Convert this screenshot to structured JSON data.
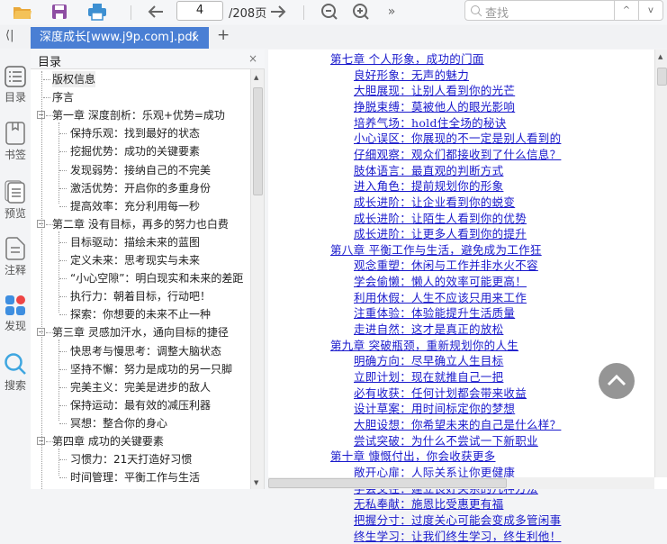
{
  "toolbar": {
    "open": "folder-icon",
    "save": "save-icon",
    "print": "print-icon",
    "page_current": "4",
    "page_total": "/208页",
    "more": "»",
    "search_placeholder": "查找",
    "search_up": "^",
    "search_down": "v"
  },
  "tabs": {
    "collapse": "⟨|",
    "active": "深度成长[www.j9p.com].pdf",
    "close": "×",
    "add": "+"
  },
  "rail": [
    {
      "label": "目录"
    },
    {
      "label": "书签"
    },
    {
      "label": "预览"
    },
    {
      "label": "注释"
    },
    {
      "label": "发现"
    },
    {
      "label": "搜索"
    }
  ],
  "toc": {
    "title": "目录",
    "close": "×",
    "items": [
      {
        "level": 0,
        "label": "版权信息"
      },
      {
        "level": 0,
        "label": "序言"
      },
      {
        "level": 0,
        "label": "第一章 深度剖析：乐观+优势=成功",
        "expanded": true
      },
      {
        "level": 1,
        "label": "保持乐观：找到最好的状态"
      },
      {
        "level": 1,
        "label": "挖掘优势：成功的关键要素"
      },
      {
        "level": 1,
        "label": "发现弱势：接纳自己的不完美"
      },
      {
        "level": 1,
        "label": "激活优势：开启你的多重身份"
      },
      {
        "level": 1,
        "label": "提高效率：充分利用每一秒"
      },
      {
        "level": 0,
        "label": "第二章 没有目标，再多的努力也白费",
        "expanded": true
      },
      {
        "level": 1,
        "label": "目标驱动：描绘未来的蓝图"
      },
      {
        "level": 1,
        "label": "定义未来：思考现实与未来"
      },
      {
        "level": 1,
        "label": "“小心空隙”：明白现实和未来的差距"
      },
      {
        "level": 1,
        "label": "执行力：朝着目标，行动吧！"
      },
      {
        "level": 1,
        "label": "探索：你想要的未来不止一种"
      },
      {
        "level": 0,
        "label": "第三章 灵感加汗水，通向目标的捷径",
        "expanded": true
      },
      {
        "level": 1,
        "label": "快思考与慢思考：调整大脑状态"
      },
      {
        "level": 1,
        "label": "坚持不懈：努力是成功的另一只脚"
      },
      {
        "level": 1,
        "label": "完美主义：完美是进步的敌人"
      },
      {
        "level": 1,
        "label": "保持运动：最有效的减压利器"
      },
      {
        "level": 1,
        "label": "冥想：整合你的身心"
      },
      {
        "level": 0,
        "label": "第四章 成功的关键要素",
        "expanded": true
      },
      {
        "level": 1,
        "label": "习惯力：21天打造好习惯"
      },
      {
        "level": 1,
        "label": "时间管理：平衡工作与生活"
      }
    ]
  },
  "content": {
    "lines": [
      {
        "level": 0,
        "text": "第七章 个人形象，成功的门面"
      },
      {
        "level": 1,
        "text": "良好形象：无声的魅力"
      },
      {
        "level": 1,
        "text": "大胆展现：让别人看到你的光芒"
      },
      {
        "level": 1,
        "text": "挣脱束缚：莫被他人的眼光影响"
      },
      {
        "level": 1,
        "text": "培养气场：hold住全场的秘诀"
      },
      {
        "level": 1,
        "text": "小心误区：你展现的不一定是别人看到的"
      },
      {
        "level": 1,
        "text": "仔细观察：观众们都接收到了什么信息？"
      },
      {
        "level": 1,
        "text": "肢体语言：最直观的判断方式"
      },
      {
        "level": 1,
        "text": "进入角色：提前规划你的形象"
      },
      {
        "level": 1,
        "text": "成长进阶：让企业看到你的蜕变"
      },
      {
        "level": 1,
        "text": "成长进阶：让陌生人看到你的优势"
      },
      {
        "level": 1,
        "text": "成长进阶：让更多人看到你的提升"
      },
      {
        "level": 0,
        "text": "第八章 平衡工作与生活，避免成为工作狂"
      },
      {
        "level": 1,
        "text": "观念重塑：休闲与工作并非水火不容"
      },
      {
        "level": 1,
        "text": "学会偷懒：懒人的效率可能更高！"
      },
      {
        "level": 1,
        "text": "利用休假：人生不应该只用来工作"
      },
      {
        "level": 1,
        "text": "注重体验：体验能提升生活质量"
      },
      {
        "level": 1,
        "text": "走进自然：这才是真正的放松"
      },
      {
        "level": 0,
        "text": "第九章 突破瓶颈，重新规划你的人生"
      },
      {
        "level": 1,
        "text": "明确方向：尽早确立人生目标"
      },
      {
        "level": 1,
        "text": "立即计划：现在就推自己一把"
      },
      {
        "level": 1,
        "text": "必有收获：任何计划都会带来收益"
      },
      {
        "level": 1,
        "text": "设计草案：用时间标定你的梦想"
      },
      {
        "level": 1,
        "text": "大胆设想：你希望未来的自己是什么样？"
      },
      {
        "level": 1,
        "text": "尝试突破：为什么不尝试一下新职业"
      },
      {
        "level": 0,
        "text": "第十章 慷慨付出，你会收获更多"
      },
      {
        "level": 1,
        "text": "敞开心扉：人际关系让你更健康"
      },
      {
        "level": 1,
        "text": "学会交往：建立良好关系的几种方法"
      },
      {
        "level": 1,
        "text": "无私奉献：施恩比受惠更有福"
      },
      {
        "level": 1,
        "text": "把握分寸：过度关心可能会变成多管闲事"
      },
      {
        "level": 1,
        "text": "终生学习：让我们终生学习，终生利他！"
      }
    ]
  },
  "colors": {
    "accent": "#4a7fd4",
    "link": "#1a1acc"
  }
}
